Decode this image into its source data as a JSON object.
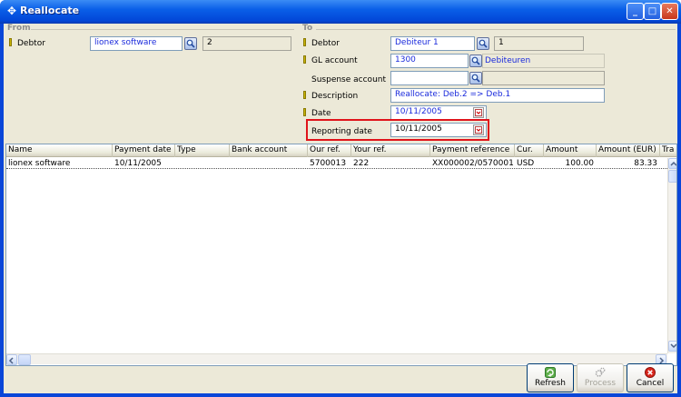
{
  "window": {
    "title": "Reallocate",
    "controls": {
      "minimize": "_",
      "maximize": "□",
      "close": "✕"
    }
  },
  "from": {
    "group_label": "From",
    "debtor_label": "Debtor",
    "debtor_value": "lionex software",
    "debtor_number": "2"
  },
  "to": {
    "group_label": "To",
    "debtor_label": "Debtor",
    "debtor_value": "Debiteur 1",
    "debtor_number": "1",
    "gl_label": "GL account",
    "gl_value": "1300",
    "gl_description": "Debiteuren",
    "suspense_label": "Suspense account",
    "suspense_value": "",
    "description_label": "Description",
    "description_value": "Reallocate: Deb.2 => Deb.1",
    "date_label": "Date",
    "date_value": "10/11/2005",
    "reporting_label": "Reporting date",
    "reporting_value": "10/11/2005"
  },
  "grid": {
    "columns": [
      "Name",
      "Payment date",
      "Type",
      "Bank account",
      "Our ref.",
      "Your ref.",
      "Payment reference",
      "Cur.",
      "Amount",
      "Amount (EUR)",
      "Tra"
    ],
    "rows": [
      {
        "name": "lionex software",
        "payment_date": "10/11/2005",
        "type": "",
        "bank_account": "",
        "our_ref": "5700013",
        "your_ref": "222",
        "payment_reference": "XX000002/0570001",
        "currency": "USD",
        "amount": "100.00",
        "amount_eur": "83.33"
      }
    ]
  },
  "buttons": {
    "refresh": "Refresh",
    "process": "Process",
    "cancel": "Cancel"
  },
  "colors": {
    "title_bar": "#0a5fe8",
    "dialog_bg": "#ece9d8",
    "field_text": "#1a2adc",
    "highlight_box": "#e0141b",
    "required_marker": "#c9b500"
  },
  "icons": {
    "lookup": "magnifier-icon",
    "dropdown": "calendar-dropdown-icon",
    "refresh": "refresh-icon",
    "process": "gears-icon",
    "cancel": "cancel-icon"
  }
}
